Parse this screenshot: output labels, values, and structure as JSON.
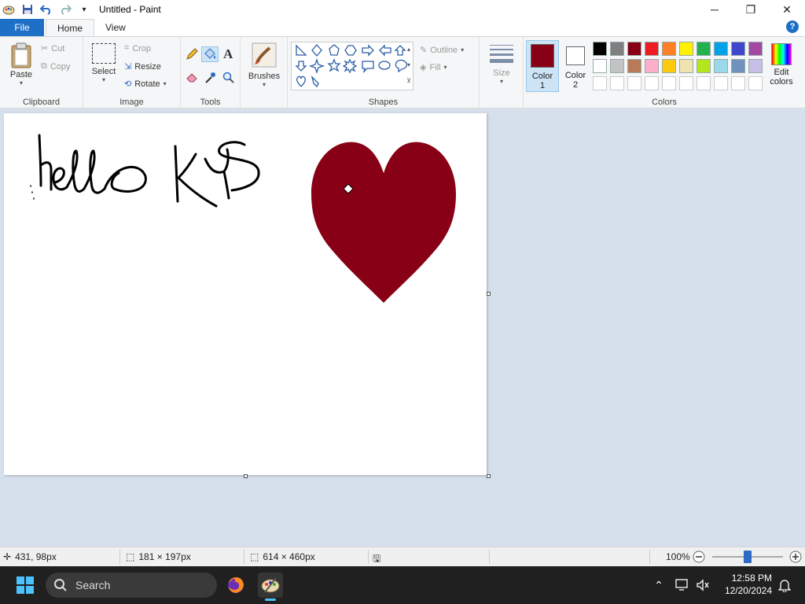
{
  "window": {
    "title": "Untitled - Paint"
  },
  "tabs": {
    "file": "File",
    "home": "Home",
    "view": "View"
  },
  "clipboard": {
    "paste": "Paste",
    "cut": "Cut",
    "copy": "Copy",
    "label": "Clipboard"
  },
  "image": {
    "select": "Select",
    "crop": "Crop",
    "resize": "Resize",
    "rotate": "Rotate",
    "label": "Image"
  },
  "tools": {
    "label": "Tools"
  },
  "brushes": {
    "label": "Brushes"
  },
  "shapes": {
    "outline": "Outline",
    "fill": "Fill",
    "label": "Shapes"
  },
  "size": {
    "label": "Size"
  },
  "colors": {
    "color1_label": "Color 1",
    "color2_label": "Color 2",
    "color1": "#880015",
    "color2": "#ffffff",
    "edit_label": "Edit colors",
    "label": "Colors",
    "palette_row1": [
      "#000000",
      "#7f7f7f",
      "#880015",
      "#ed1c24",
      "#ff7f27",
      "#fff200",
      "#22b14c",
      "#00a2e8",
      "#3f48cc",
      "#a349a4"
    ],
    "palette_row2": [
      "#ffffff",
      "#c3c3c3",
      "#b97a57",
      "#ffaec9",
      "#ffc90e",
      "#efe4b0",
      "#b5e61d",
      "#99d9ea",
      "#7092be",
      "#c8bfe7"
    ],
    "palette_row3": [
      "#ffffff",
      "#ffffff",
      "#ffffff",
      "#ffffff",
      "#ffffff",
      "#ffffff",
      "#ffffff",
      "#ffffff",
      "#ffffff",
      "#ffffff"
    ]
  },
  "canvas": {
    "heart_color": "#880015"
  },
  "status": {
    "cursor_pos": "431, 98px",
    "selection_size": "181 × 197px",
    "image_size": "614 × 460px",
    "zoom": "100%",
    "zoom_fraction": 0.5
  },
  "taskbar": {
    "search": "Search",
    "time": "12:58 PM",
    "date": "12/20/2024"
  }
}
